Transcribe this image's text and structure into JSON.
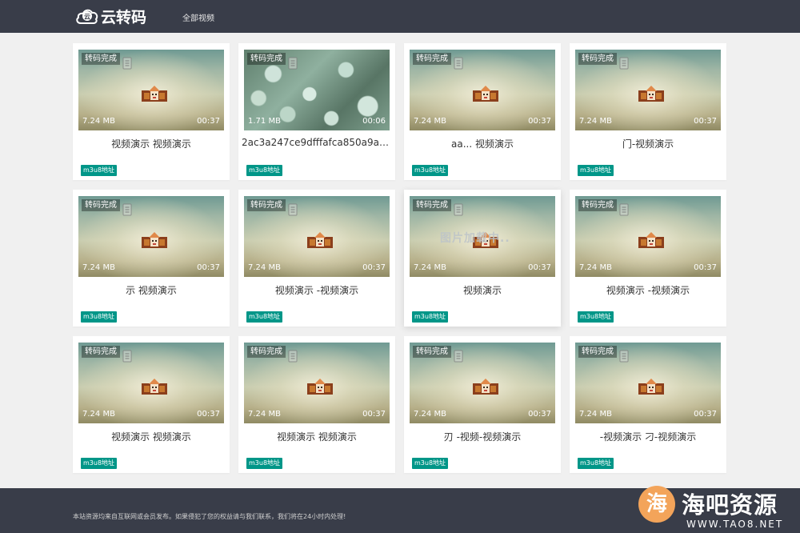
{
  "header": {
    "logo_text": "云转码",
    "nav": [
      "全部视频"
    ]
  },
  "cards": [
    {
      "status": "转码完成",
      "size": "7.24 MB",
      "duration": "00:37",
      "title": "视频演示    视频演示",
      "tag": "m3u8地址",
      "thumb": "default"
    },
    {
      "status": "转码完成",
      "size": "1.71 MB",
      "duration": "00:06",
      "title": "2ac3a247ce9dfffafca850a9aa...",
      "tag": "m3u8地址",
      "thumb": "plant"
    },
    {
      "status": "转码完成",
      "size": "7.24 MB",
      "duration": "00:37",
      "title": "aa...   视频演示",
      "tag": "m3u8地址",
      "thumb": "default"
    },
    {
      "status": "转码完成",
      "size": "7.24 MB",
      "duration": "00:37",
      "title": "门-视频演示",
      "tag": "m3u8地址",
      "thumb": "default"
    },
    {
      "status": "转码完成",
      "size": "7.24 MB",
      "duration": "00:37",
      "title": "示      视频演示",
      "tag": "m3u8地址",
      "thumb": "default"
    },
    {
      "status": "转码完成",
      "size": "7.24 MB",
      "duration": "00:37",
      "title": "视频演示  -视频演示",
      "tag": "m3u8地址",
      "thumb": "default"
    },
    {
      "status": "转码完成",
      "size": "7.24 MB",
      "duration": "00:37",
      "title": "视频演示",
      "tag": "m3u8地址",
      "thumb": "default",
      "loading": "图片加载中.."
    },
    {
      "status": "转码完成",
      "size": "7.24 MB",
      "duration": "00:37",
      "title": "视频演示  -视频演示",
      "tag": "m3u8地址",
      "thumb": "default"
    },
    {
      "status": "转码完成",
      "size": "7.24 MB",
      "duration": "00:37",
      "title": "视频演示    视频演示",
      "tag": "m3u8地址",
      "thumb": "default"
    },
    {
      "status": "转码完成",
      "size": "7.24 MB",
      "duration": "00:37",
      "title": "视频演示    视频演示",
      "tag": "m3u8地址",
      "thumb": "default"
    },
    {
      "status": "转码完成",
      "size": "7.24 MB",
      "duration": "00:37",
      "title": "刃   -视频-视频演示",
      "tag": "m3u8地址",
      "thumb": "default"
    },
    {
      "status": "转码完成",
      "size": "7.24 MB",
      "duration": "00:37",
      "title": "-视频演示 刁-视频演示",
      "tag": "m3u8地址",
      "thumb": "default"
    }
  ],
  "footer": {
    "notice": "本站资源均来自互联网或会员发布。如果侵犯了您的权益请与我们联系，我们将在24小时内处理!"
  },
  "watermark": {
    "glyph": "海",
    "name": "海吧资源",
    "url": "WWW.TAO8.NET"
  },
  "colors": {
    "header_bg": "#393d49",
    "tag_bg": "#009688",
    "page_bg": "#f0f0f0"
  }
}
